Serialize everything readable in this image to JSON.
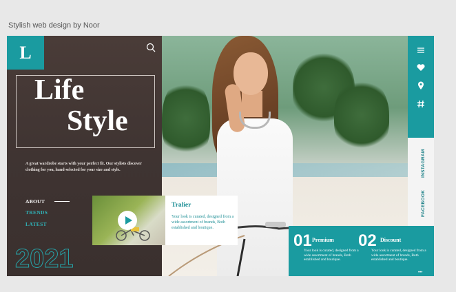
{
  "canvas": {
    "title": "Stylish web design by Noor"
  },
  "brand": {
    "logo_letter": "L",
    "accent": "#1a9ba0"
  },
  "hero": {
    "title_line1": "Life",
    "title_line2": "Style",
    "description": "A great wardrobe starts with your perfect fit. Our stylists discover clothing for you, hand-selected for your size and style.",
    "year": "2021"
  },
  "nav": {
    "items": [
      "ABOUT",
      "TRENDS",
      "LATEST"
    ]
  },
  "sidebar": {
    "icons": [
      "menu-icon",
      "heart-icon",
      "location-pin-icon",
      "hashtag-icon"
    ],
    "social": [
      "INSTAGRAM",
      "FACEBOOK"
    ]
  },
  "trailer": {
    "title": "Tralier",
    "description": "Your look is curated, designed from a wide assortment of brands, Both established and boutique."
  },
  "features": [
    {
      "number": "01",
      "title": "Premium",
      "description": "Your look is curated, designed from a wide assortment of brands, Both established and boutique."
    },
    {
      "number": "02",
      "title": "Discount",
      "description": "Your look is curated, designed from a wide assortment of brands, Both established and boutique."
    }
  ]
}
